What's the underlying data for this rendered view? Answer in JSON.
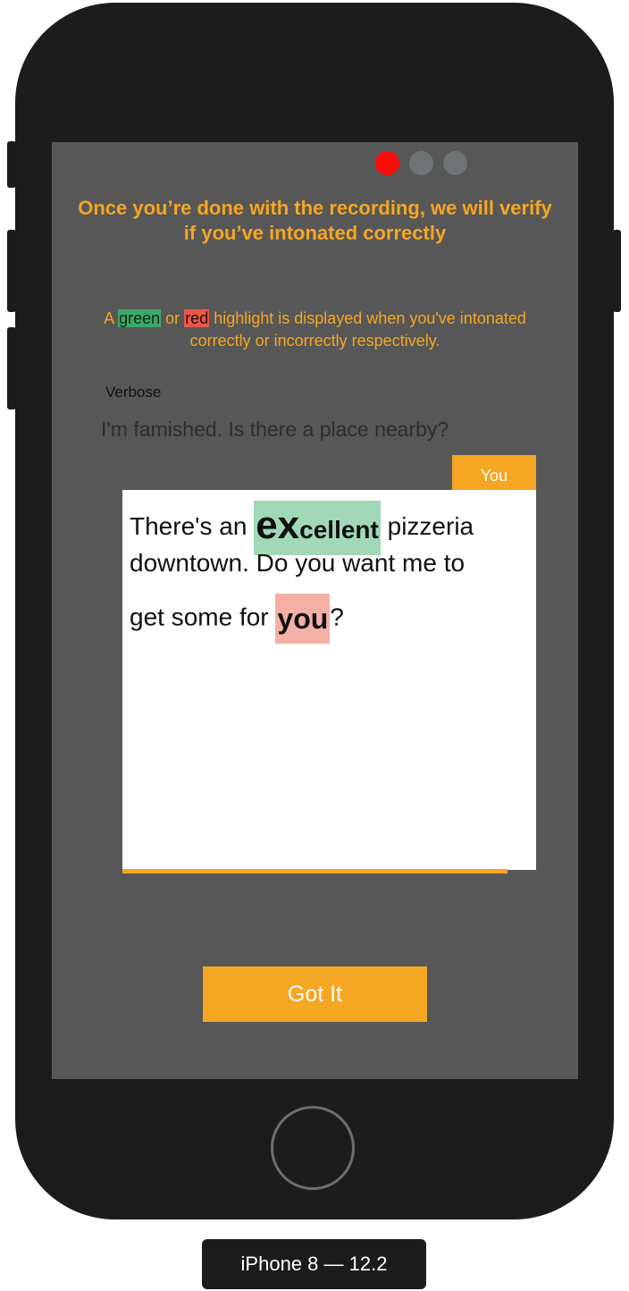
{
  "pager": {
    "total": 3,
    "active_index": 0,
    "active_color": "#ff0a0a",
    "inactive_color": "#6b7575"
  },
  "heading": "Once you’re done with the recording, we will verify if you’ve intonated correctly",
  "hint": {
    "prefix": "A ",
    "green_word": "green",
    "middle": " or ",
    "red_word": "red",
    "suffix": " highlight is displayed when you've intonated correctly or incorrectly respectively."
  },
  "dialog": {
    "speaker_label": "Verbose",
    "prompt": "I'm famished. Is there a place nearby?",
    "you_tag": "You",
    "response": {
      "part1": "There's an ",
      "green_big": "ex",
      "green_rest": "cellent",
      "part2": " pizzeria",
      "line2": "downtown. Do you want me to",
      "part3": "get some for ",
      "red_word": "you",
      "part4": "?"
    },
    "recording_progress": 0.93
  },
  "got_it_label": "Got It",
  "device_label": "iPhone 8 — 12.2",
  "colors": {
    "accent": "#f5a623",
    "screen_bg": "#575757",
    "correct_highlight": "#a1d9b6",
    "incorrect_highlight": "#f5b0a6"
  }
}
